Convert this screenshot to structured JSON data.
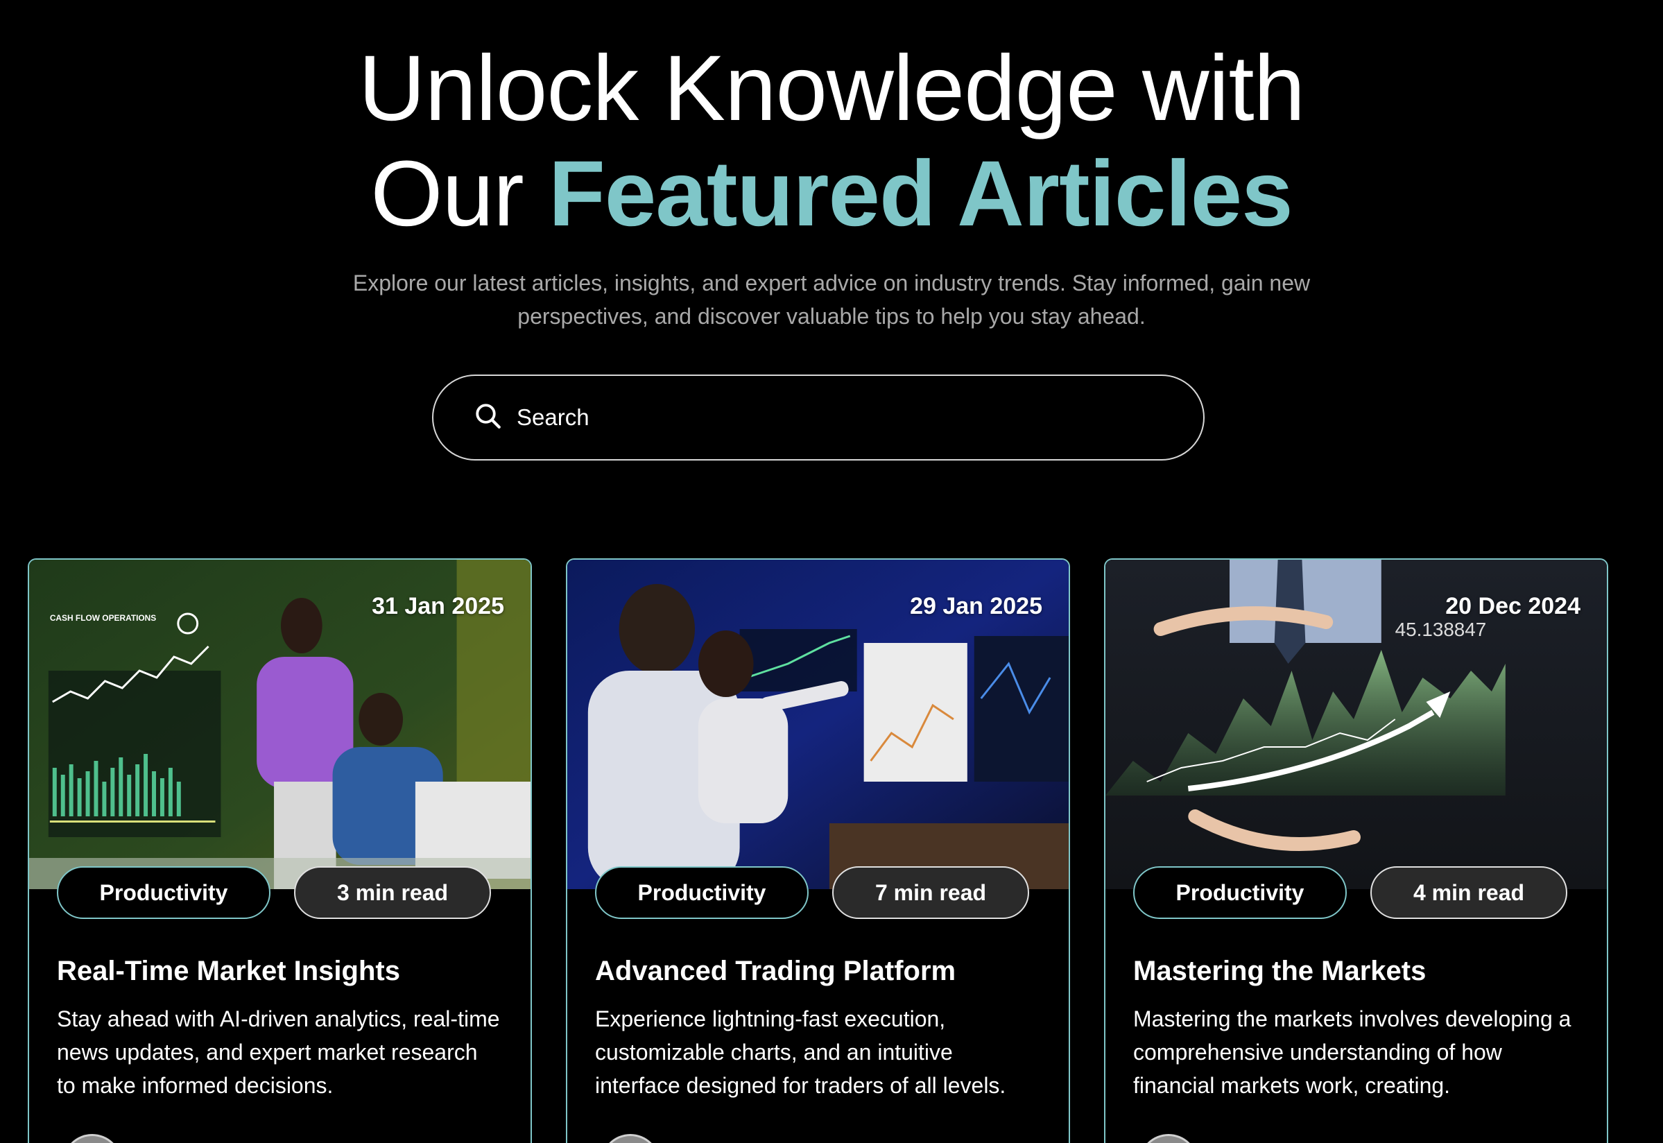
{
  "hero": {
    "title_line1": "Unlock Knowledge with",
    "title_line2_plain": "Our ",
    "title_line2_accent": "Featured Articles",
    "subtitle": "Explore our latest articles, insights, and expert advice on industry trends. Stay informed, gain new perspectives, and discover valuable tips to help you stay ahead."
  },
  "search": {
    "placeholder": "Search",
    "icon": "search-icon"
  },
  "colors": {
    "accent": "#7fc6c8",
    "background": "#000000",
    "muted_text": "#a9a9a9"
  },
  "cards": [
    {
      "date": "31 Jan 2025",
      "category": "Productivity",
      "read_time": "3 min read",
      "title": "Real-Time Market Insights",
      "description": "Stay ahead with AI-driven analytics, real-time news updates, and expert market research to make informed decisions.",
      "image_text": "CASH FLOW OPERATIONS"
    },
    {
      "date": "29 Jan 2025",
      "category": "Productivity",
      "read_time": "7 min read",
      "title": "Advanced Trading Platform",
      "description": "Experience lightning-fast execution, customizable charts, and an intuitive interface designed for traders of all levels."
    },
    {
      "date": "20 Dec 2024",
      "category": "Productivity",
      "read_time": "4 min read",
      "title": "Mastering the Markets",
      "description": "Mastering the markets involves developing a comprehensive understanding of how financial markets work, creating.",
      "image_text": "45.138847"
    }
  ]
}
